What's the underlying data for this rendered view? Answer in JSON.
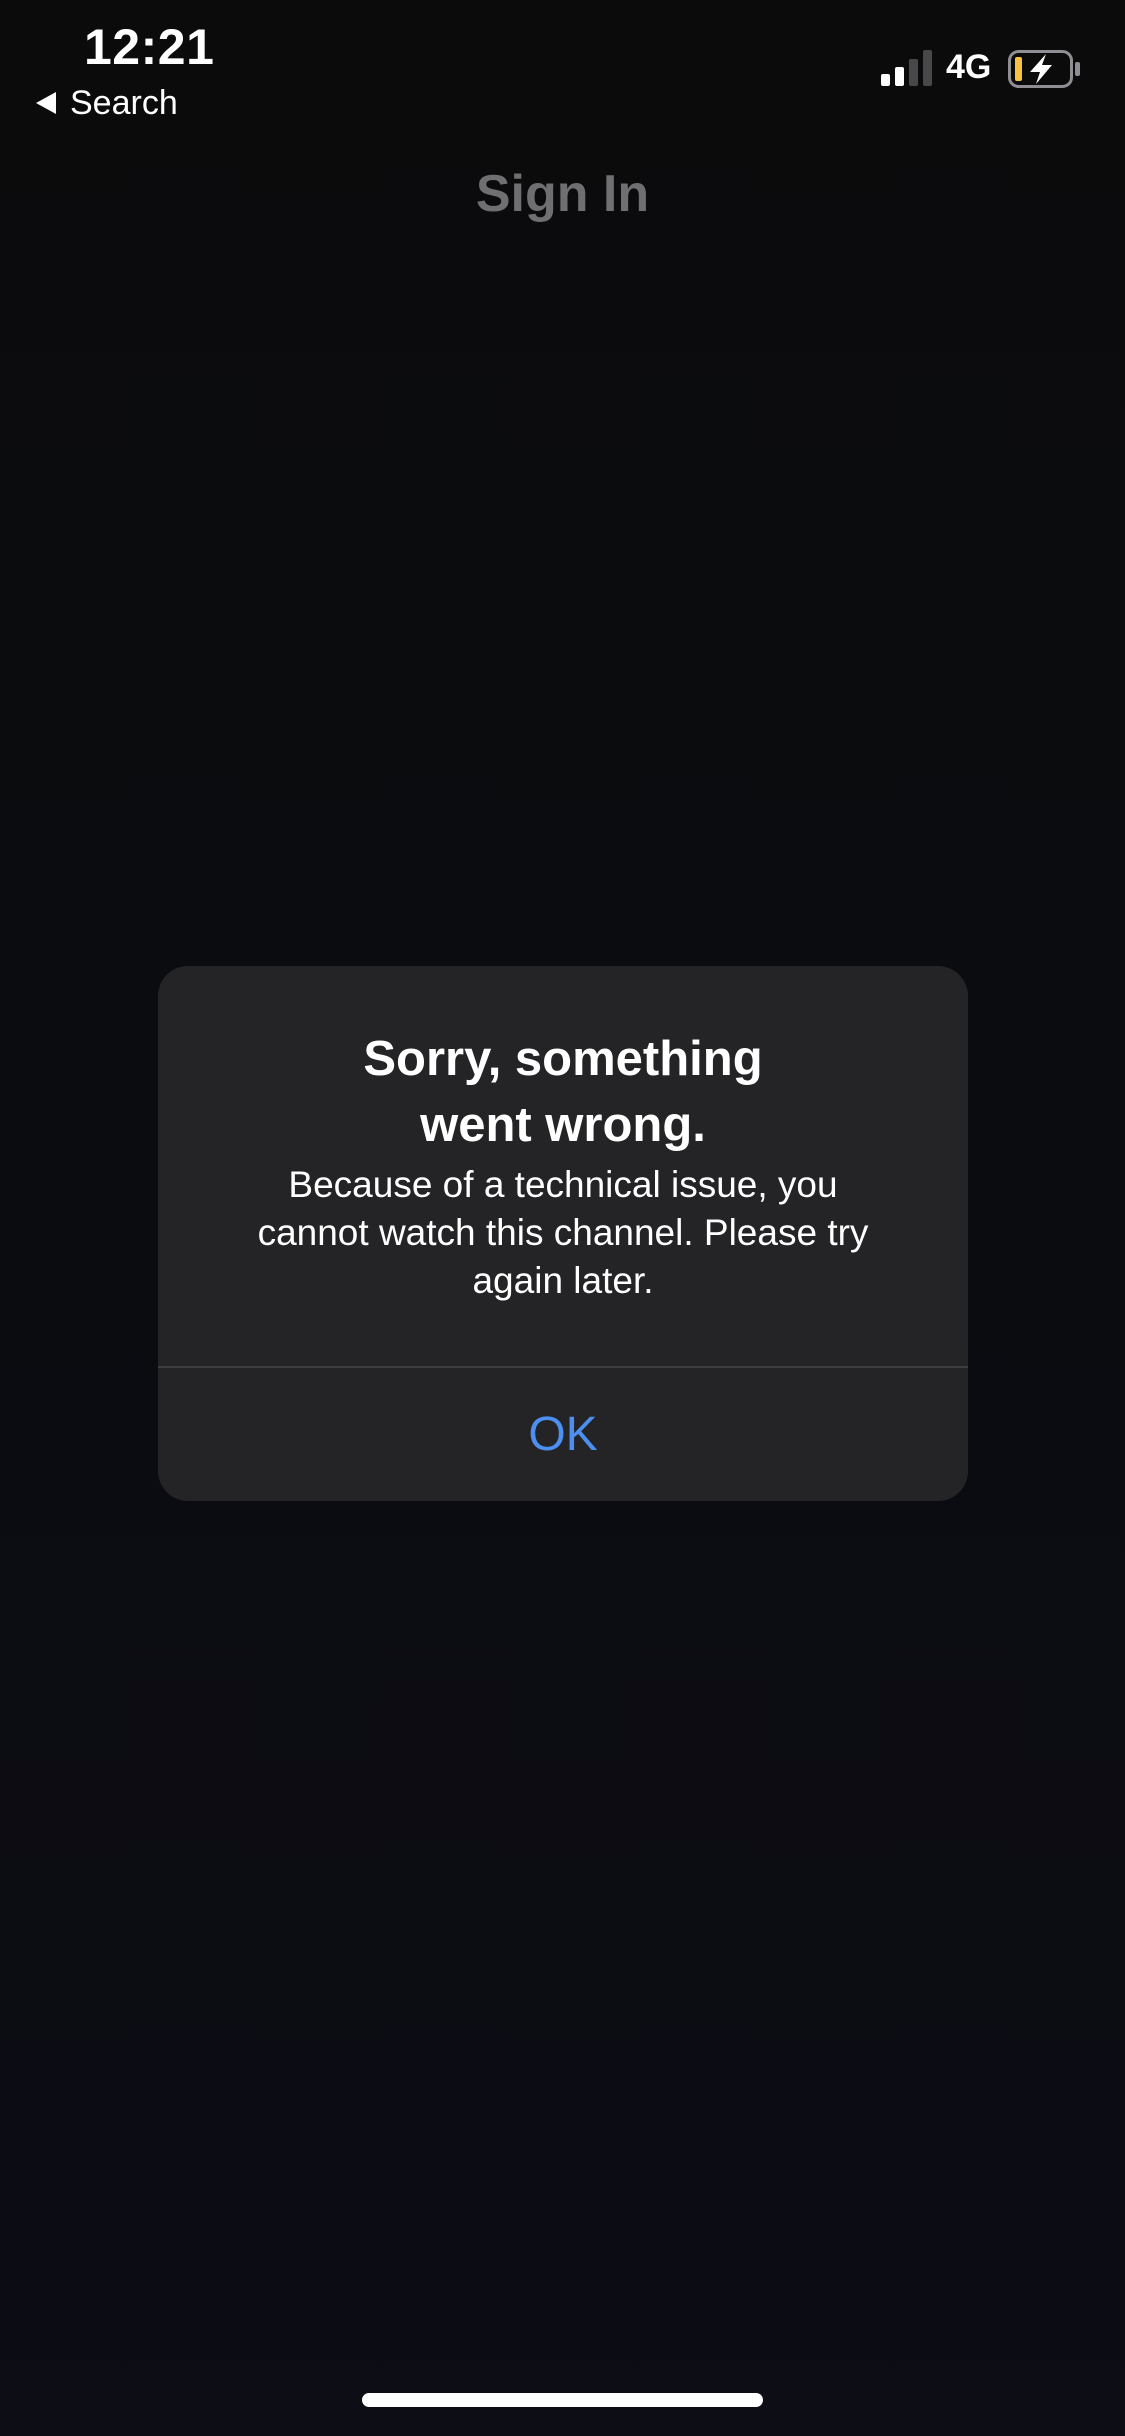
{
  "status_bar": {
    "time": "12:21",
    "back_label": "Search",
    "network": "4G",
    "signal_bars_active": 2,
    "signal_bars_total": 4,
    "battery_charging": true,
    "battery_level_color": "#f5c242"
  },
  "page": {
    "title": "Sign In"
  },
  "alert": {
    "title_line1": "Sorry, something",
    "title_line2": "went wrong.",
    "message_line1": "Because of a technical issue, you",
    "message_line2": "cannot watch this channel. Please try",
    "message_line3": "again later.",
    "ok_label": "OK",
    "accent_color": "#4c8ff0"
  }
}
